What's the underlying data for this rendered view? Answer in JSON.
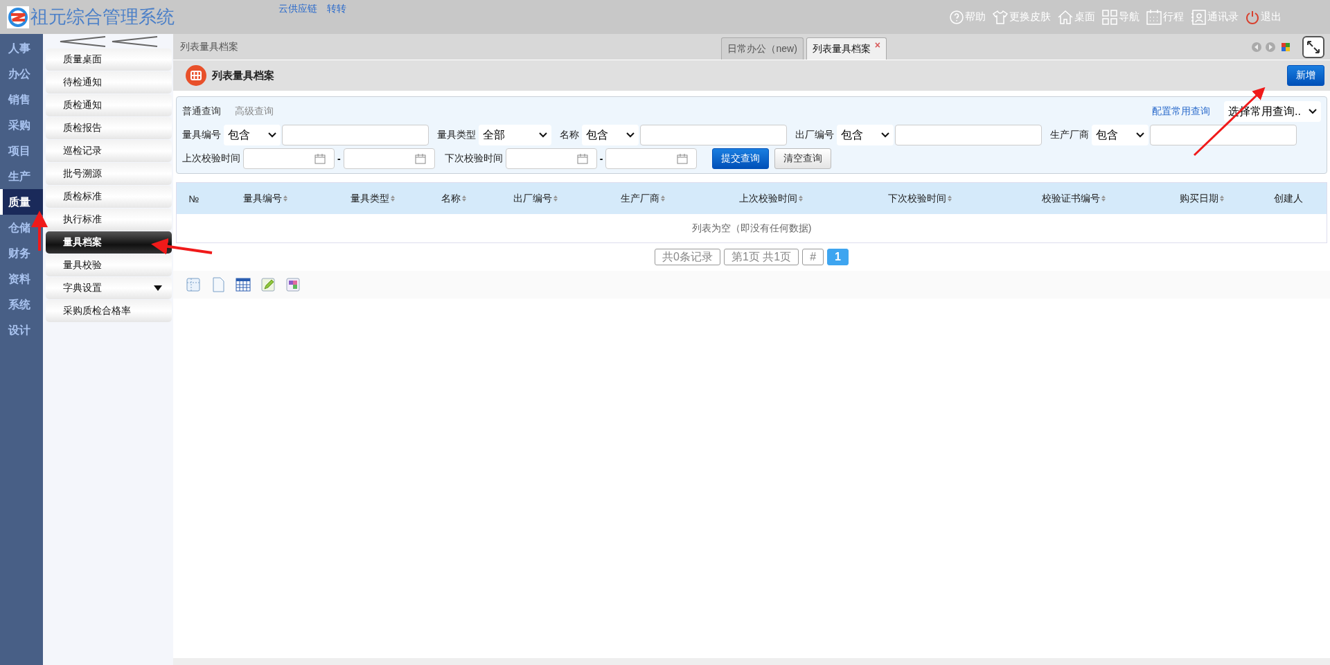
{
  "header": {
    "title": "祖元综合管理系统",
    "links": [
      "云供应链",
      "转转"
    ],
    "actions": [
      {
        "kind": "help",
        "label": "帮助"
      },
      {
        "kind": "skin",
        "label": "更换皮肤"
      },
      {
        "kind": "home",
        "label": "桌面"
      },
      {
        "kind": "nav",
        "label": "导航"
      },
      {
        "kind": "calendar",
        "label": "行程"
      },
      {
        "kind": "contacts",
        "label": "通讯录"
      },
      {
        "kind": "power",
        "label": "退出"
      }
    ]
  },
  "modules": [
    {
      "label": "人事",
      "selected": false
    },
    {
      "label": "办公",
      "selected": false
    },
    {
      "label": "销售",
      "selected": false
    },
    {
      "label": "采购",
      "selected": false
    },
    {
      "label": "项目",
      "selected": false
    },
    {
      "label": "生产",
      "selected": false
    },
    {
      "label": "质量",
      "selected": true
    },
    {
      "label": "仓储",
      "selected": false
    },
    {
      "label": "财务",
      "selected": false
    },
    {
      "label": "资料",
      "selected": false
    },
    {
      "label": "系统",
      "selected": false
    },
    {
      "label": "设计",
      "selected": false
    }
  ],
  "submenu": [
    {
      "label": "质量桌面",
      "selected": false,
      "has_children": false
    },
    {
      "label": "待检通知",
      "selected": false,
      "has_children": false
    },
    {
      "label": "质检通知",
      "selected": false,
      "has_children": false
    },
    {
      "label": "质检报告",
      "selected": false,
      "has_children": false
    },
    {
      "label": "巡检记录",
      "selected": false,
      "has_children": false
    },
    {
      "label": "批号溯源",
      "selected": false,
      "has_children": false
    },
    {
      "label": "质检标准",
      "selected": false,
      "has_children": false
    },
    {
      "label": "执行标准",
      "selected": false,
      "has_children": false
    },
    {
      "label": "量具档案",
      "selected": true,
      "has_children": false
    },
    {
      "label": "量具校验",
      "selected": false,
      "has_children": false
    },
    {
      "label": "字典设置",
      "selected": false,
      "has_children": true
    },
    {
      "label": "采购质检合格率",
      "selected": false,
      "has_children": false
    }
  ],
  "breadcrumb": "列表量具档案",
  "tabs": [
    {
      "label": "日常办公（new)",
      "selected": false,
      "closable": false
    },
    {
      "label": "列表量具档案",
      "selected": true,
      "closable": true,
      "close": "×"
    }
  ],
  "page_title": "列表量具档案",
  "add_button": "新增",
  "query": {
    "modes": [
      {
        "label": "普通查询",
        "selected": true
      },
      {
        "label": "高级查询",
        "selected": false
      }
    ],
    "config_link": "配置常用查询",
    "saved_select": "选择常用查询..",
    "row1": [
      {
        "kind": "text",
        "label": "量具编号",
        "op": "包含"
      },
      {
        "kind": "select",
        "label": "量具类型",
        "value": "全部"
      },
      {
        "kind": "text",
        "label": "名称",
        "op": "包含"
      },
      {
        "kind": "text",
        "label": "出厂编号",
        "op": "包含"
      },
      {
        "kind": "text",
        "label": "生产厂商",
        "op": "包含"
      }
    ],
    "row2": [
      {
        "label": "上次校验时间",
        "separator": "-"
      },
      {
        "label": "下次校验时间",
        "separator": "-"
      }
    ],
    "submit": "提交查询",
    "clear": "清空查询"
  },
  "table": {
    "columns": [
      {
        "label": "№",
        "sortable": false
      },
      {
        "label": "量具编号",
        "sortable": true
      },
      {
        "label": "量具类型",
        "sortable": true
      },
      {
        "label": "名称",
        "sortable": true
      },
      {
        "label": "出厂编号",
        "sortable": true
      },
      {
        "label": "生产厂商",
        "sortable": true
      },
      {
        "label": "上次校验时间",
        "sortable": true
      },
      {
        "label": "下次校验时间",
        "sortable": true
      },
      {
        "label": "校验证书编号",
        "sortable": true
      },
      {
        "label": "购买日期",
        "sortable": true
      },
      {
        "label": "创建人",
        "sortable": false
      }
    ],
    "empty": "列表为空（即没有任何数据)"
  },
  "pager": [
    {
      "label": "共0条记录",
      "selected": false
    },
    {
      "label": "第1页 共1页",
      "selected": false
    },
    {
      "label": "#",
      "selected": false
    },
    {
      "label": "1",
      "selected": true
    }
  ]
}
